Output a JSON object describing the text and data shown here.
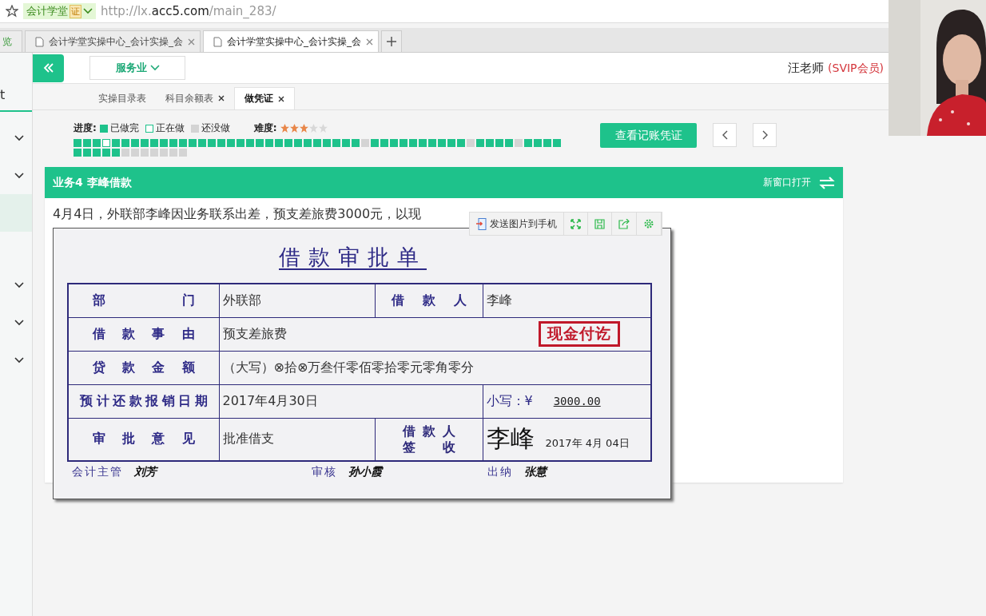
{
  "browser": {
    "site_badge": "会计学堂",
    "cert_badge": "证",
    "url_prefix": "http://lx.",
    "url_domain": "acc5.com",
    "url_path": "/main_283/",
    "tabs": [
      {
        "title": "览",
        "kind": "partial",
        "selected": false
      },
      {
        "title": "会计学堂实操中心_会计实操_会",
        "kind": "page",
        "selected": false
      },
      {
        "title": "会计学堂实操中心_会计实操_会",
        "kind": "page",
        "selected": true
      }
    ]
  },
  "sidebar": {
    "label": "t",
    "items": [
      {
        "kind": "group",
        "selected": false
      },
      {
        "kind": "group",
        "selected": false
      },
      {
        "kind": "link",
        "selected": true
      },
      {
        "kind": "group",
        "selected": false
      },
      {
        "kind": "group",
        "selected": false
      },
      {
        "kind": "group",
        "selected": false
      }
    ]
  },
  "header": {
    "industry": "服务业",
    "user": "汪老师",
    "role": "(SVIP会员)"
  },
  "page_tabs": [
    {
      "label": "实操目录表",
      "closable": false,
      "selected": false
    },
    {
      "label": "科目余额表",
      "closable": true,
      "selected": false
    },
    {
      "label": "做凭证",
      "closable": true,
      "selected": true
    }
  ],
  "progress": {
    "label": "进度:",
    "legend": [
      {
        "kind": "done",
        "label": "已做完"
      },
      {
        "kind": "current",
        "label": "正在做"
      },
      {
        "kind": "todo",
        "label": "还没做"
      }
    ],
    "difficulty_label": "难度:",
    "stars": 3,
    "squares": [
      {
        "kind": "done"
      },
      {
        "kind": "done"
      },
      {
        "kind": "done"
      },
      {
        "kind": "current"
      },
      {
        "kind": "done"
      },
      {
        "kind": "done"
      },
      {
        "kind": "done"
      },
      {
        "kind": "done"
      },
      {
        "kind": "done"
      },
      {
        "kind": "done"
      },
      {
        "kind": "done"
      },
      {
        "kind": "done"
      },
      {
        "kind": "done"
      },
      {
        "kind": "done"
      },
      {
        "kind": "done"
      },
      {
        "kind": "done"
      },
      {
        "kind": "done"
      },
      {
        "kind": "done"
      },
      {
        "kind": "done"
      },
      {
        "kind": "done"
      },
      {
        "kind": "done"
      },
      {
        "kind": "done"
      },
      {
        "kind": "done"
      },
      {
        "kind": "done"
      },
      {
        "kind": "done"
      },
      {
        "kind": "done"
      },
      {
        "kind": "done"
      },
      {
        "kind": "done"
      },
      {
        "kind": "done"
      },
      {
        "kind": "done"
      },
      {
        "kind": "todo"
      },
      {
        "kind": "done"
      },
      {
        "kind": "done"
      },
      {
        "kind": "done"
      },
      {
        "kind": "done"
      },
      {
        "kind": "done"
      },
      {
        "kind": "done"
      },
      {
        "kind": "done"
      },
      {
        "kind": "done"
      },
      {
        "kind": "done"
      },
      {
        "kind": "done"
      },
      {
        "kind": "todo"
      },
      {
        "kind": "done"
      },
      {
        "kind": "done"
      },
      {
        "kind": "done"
      },
      {
        "kind": "done"
      },
      {
        "kind": "todo"
      },
      {
        "kind": "done"
      },
      {
        "kind": "done"
      },
      {
        "kind": "done"
      },
      {
        "kind": "done"
      },
      {
        "kind": "done"
      },
      {
        "kind": "done"
      },
      {
        "kind": "done"
      },
      {
        "kind": "done"
      },
      {
        "kind": "done"
      },
      {
        "kind": "todo"
      },
      {
        "kind": "todo"
      },
      {
        "kind": "todo"
      },
      {
        "kind": "todo"
      },
      {
        "kind": "todo"
      },
      {
        "kind": "todo"
      },
      {
        "kind": "todo"
      }
    ]
  },
  "view_button": "查看记账凭证",
  "task": {
    "title": "业务4 李峰借款",
    "open_new": "新窗口打开",
    "description": "4月4日，外联部李峰因业务联系出差，预支差旅费3000元，以现",
    "toolbar": {
      "send": "发送图片到手机"
    },
    "form": {
      "title": "借款审批单",
      "department_label": "部门",
      "department": "外联部",
      "borrower_label": "借款人",
      "borrower": "李峰",
      "reason_label": "借款事由",
      "reason": "预支差旅费",
      "stamp": "现金付讫",
      "amount_label": "贷款金额",
      "amount_words": "（大写）⊗拾⊗万叁仟零佰零拾零元零角零分",
      "due_label": "预计还款报销日期",
      "due_date": "2017年4月30日",
      "small_label": "小写：¥",
      "small_amount": "3000.00",
      "opinion_label": "审批意见",
      "opinion": "批准借支",
      "sign_label_lines": [
        "借款人",
        "签收"
      ],
      "signature": "李峰",
      "sign_date": "2017年 4月 04日",
      "footer": [
        {
          "label": "会计主管",
          "name": "刘芳"
        },
        {
          "label": "审核",
          "name": "孙小霞"
        },
        {
          "label": "出纳",
          "name": "张慧"
        }
      ]
    }
  }
}
